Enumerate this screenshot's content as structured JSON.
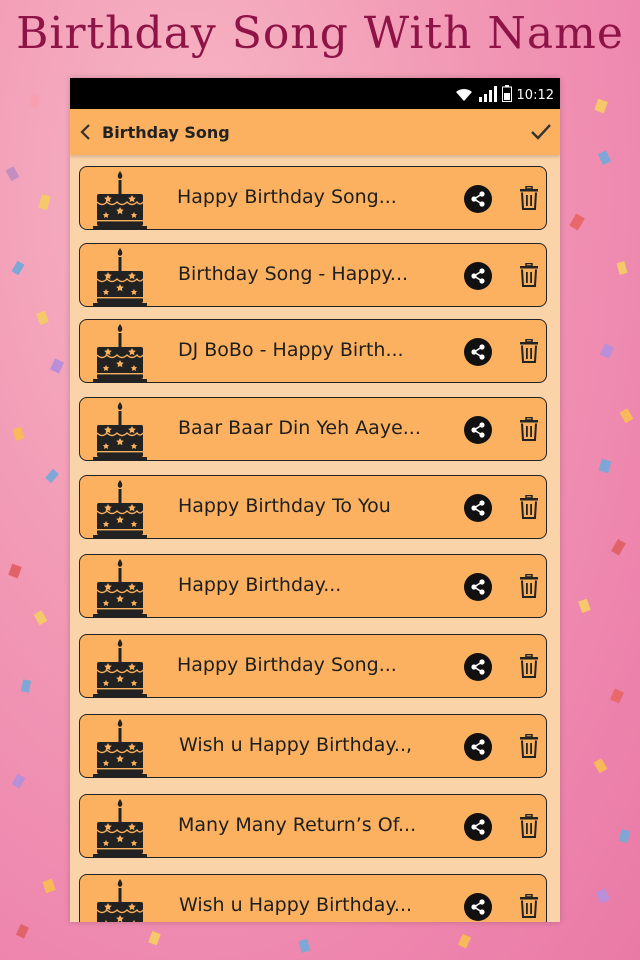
{
  "banner": {
    "title": "Birthday Song With Name"
  },
  "status_bar": {
    "time": "10:12"
  },
  "app_bar": {
    "title": "Birthday Song"
  },
  "songs": [
    {
      "title": "Happy Birthday Song..."
    },
    {
      "title": "Birthday Song - Happy..."
    },
    {
      "title": "DJ BoBo - Happy Birth..."
    },
    {
      "title": "Baar Baar Din Yeh Aaye..."
    },
    {
      "title": "Happy Birthday To You"
    },
    {
      "title": "Happy Birthday..."
    },
    {
      "title": "Happy Birthday Song..."
    },
    {
      "title": "Wish u Happy Birthday..,"
    },
    {
      "title": "Many Many Return’s Of..."
    },
    {
      "title": "Wish u Happy Birthday..."
    }
  ],
  "icons": {
    "back": "chevron-left-icon",
    "confirm": "check-icon",
    "thumbnail": "birthday-cake-icon",
    "share": "share-icon",
    "delete": "trash-icon"
  },
  "colors": {
    "banner_text": "#8e1346",
    "app_bar": "#fbb15f",
    "list_bg": "#fbd3a9",
    "item_bg": "#fbb15f",
    "status_bar": "#000000"
  }
}
